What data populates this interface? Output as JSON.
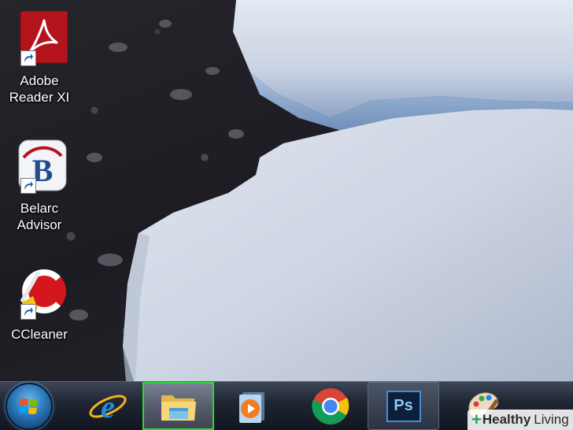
{
  "desktop": {
    "icons": [
      {
        "label": "Adobe\nReader XI",
        "icon": "adobe-reader-icon"
      },
      {
        "label": "Belarc\nAdvisor",
        "icon": "belarc-advisor-icon"
      },
      {
        "label": "CCleaner",
        "icon": "ccleaner-icon"
      }
    ]
  },
  "taskbar": {
    "items": [
      {
        "icon": "windows-start-orb-icon"
      },
      {
        "icon": "internet-explorer-icon"
      },
      {
        "icon": "file-explorer-icon",
        "state": "highlighted"
      },
      {
        "icon": "windows-media-player-icon"
      },
      {
        "icon": "google-chrome-icon"
      },
      {
        "icon": "photoshop-icon",
        "text": "Ps"
      },
      {
        "icon": "paint-icon"
      }
    ],
    "highlight_color": "#2fd82f"
  },
  "watermark": {
    "plus": "+",
    "bold": "Healthy",
    "light": "Living"
  }
}
